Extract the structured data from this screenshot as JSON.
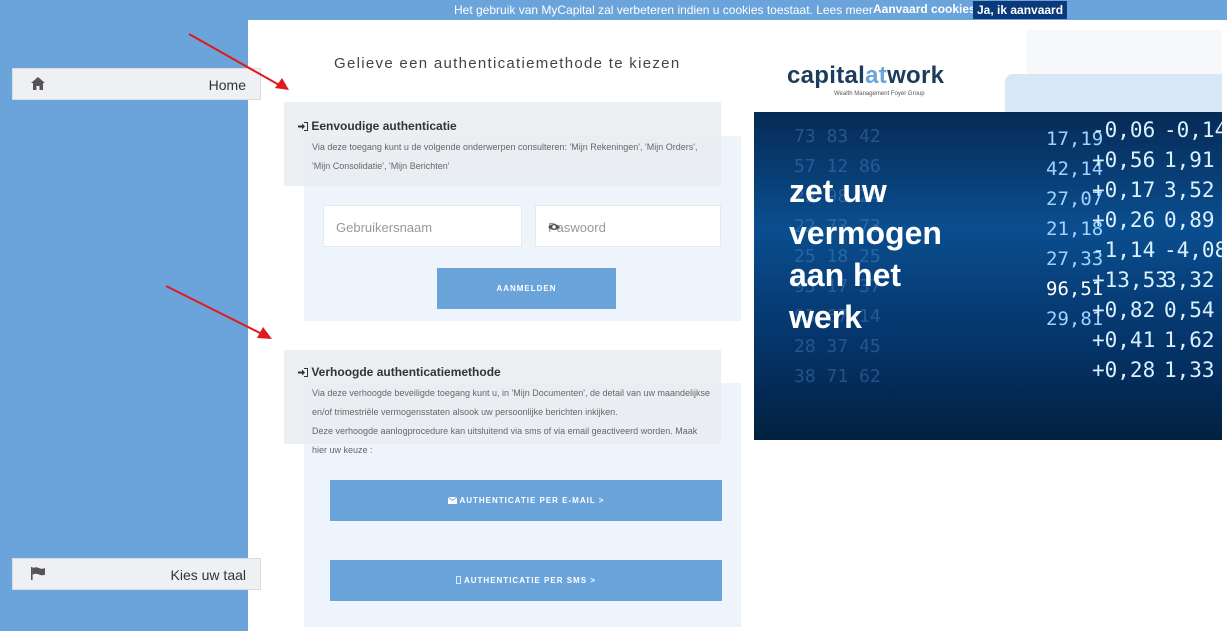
{
  "cookie_bar": {
    "message": "Het gebruik van MyCapital zal verbeteren indien u cookies toestaat. Lees meer",
    "accept_question": "Aanvaard cookies ?",
    "accept_button": "Ja, ik aanvaard"
  },
  "sidebar": {
    "home": {
      "label": "Home",
      "icon": "home-icon"
    },
    "language": {
      "label": "Kies uw taal",
      "icon": "flag-icon"
    }
  },
  "main": {
    "title": "Gelieve een authenticatiemethode te kiezen",
    "simple": {
      "title": "Eenvoudige authenticatie",
      "desc_line1": "Via deze toegang kunt u de volgende onderwerpen consulteren: 'Mijn Rekeningen', 'Mijn Orders',",
      "desc_line2": "'Mijn Consolidatie', 'Mijn Berichten'",
      "username_placeholder": "Gebruikersnaam",
      "password_placeholder": "Paswoord",
      "login_button": "AANMELDEN"
    },
    "advanced": {
      "title": "Verhoogde authenticatiemethode",
      "desc_line1": "Via deze verhoogde beveiligde toegang kunt u, in 'Mijn Documenten', de detail van uw maandelijkse",
      "desc_line2": "en/of trimestriële vermogensstaten alsook uw persoonlijke berichten inkijken.",
      "desc_line3": "Deze verhoogde aanlogprocedure kan uitsluitend via sms of via email geactiveerd worden. Maak",
      "desc_line4": "hier uw keuze :",
      "email_button": "AUTHENTICATIE PER E-MAIL >",
      "sms_button": "AUTHENTICATIE PER SMS >"
    }
  },
  "banner": {
    "logo_capital": "capital",
    "logo_at": "at",
    "logo_work": "work",
    "logo_sub": "Wealth Management  Foyer Group",
    "slogan_line1": "zet uw",
    "slogan_line2": "vermogen",
    "slogan_line3": "aan het",
    "slogan_line4": "werk",
    "tickers": {
      "col1": [
        "17,19",
        "42,14",
        "27,07",
        "21,18",
        "27,33",
        "96,51",
        "29,81"
      ],
      "col2": [
        "-0,06",
        "+0,56",
        "+0,17",
        "+0,26",
        "-1,14",
        "+13,53",
        "+0,82",
        "+0,41",
        "+0,28"
      ],
      "col3": [
        "-0,14",
        "1,91",
        "3,52",
        "0,89",
        "-4,08",
        "3,32",
        "0,54",
        "1,62",
        "1,33"
      ]
    }
  },
  "colors": {
    "accent": "#6ba3db",
    "annotation_arrow": "#e0191b"
  }
}
